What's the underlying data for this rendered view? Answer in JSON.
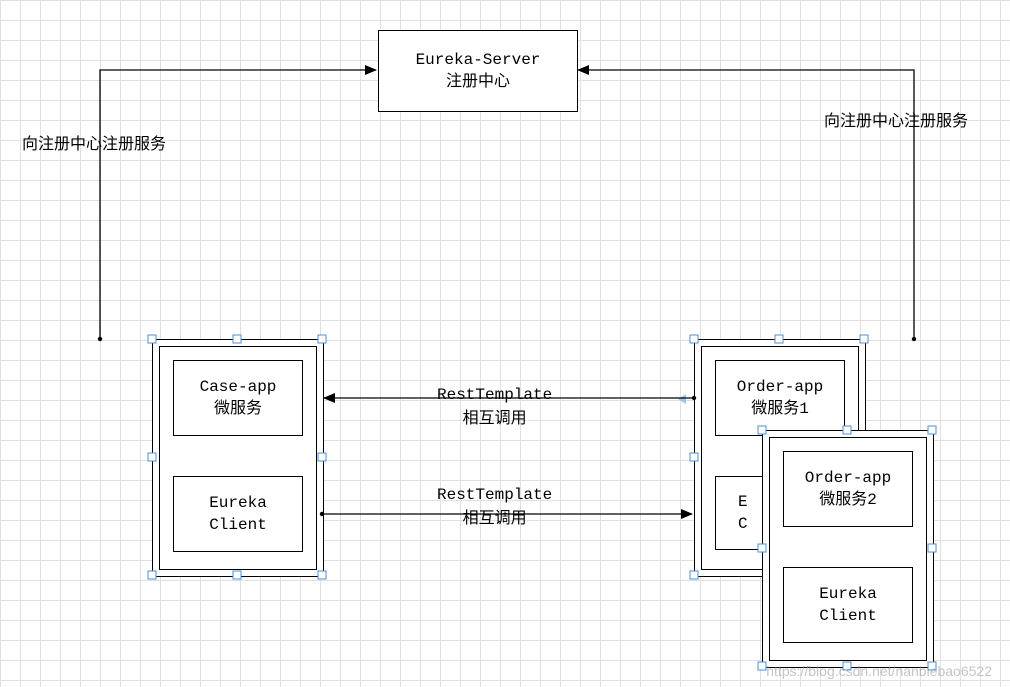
{
  "eureka_server": {
    "line1": "Eureka-Server",
    "line2": "注册中心"
  },
  "case_app": {
    "line1": "Case-app",
    "line2": "微服务"
  },
  "case_client": {
    "line1": "Eureka",
    "line2": "Client"
  },
  "order1": {
    "line1": "Order-app",
    "line2": "微服务1"
  },
  "order1_client_partial": {
    "line1": "E",
    "line2": "C"
  },
  "order2": {
    "line1": "Order-app",
    "line2": "微服务2"
  },
  "order2_client": {
    "line1": "Eureka",
    "line2": "Client"
  },
  "labels": {
    "left_register": "向注册中心注册服务",
    "right_register": "向注册中心注册服务",
    "rest_top": "RestTemplate\n相互调用",
    "rest_bottom": "RestTemplate\n相互调用"
  },
  "watermark": "https://blog.csdn.net/nanbiebao6522"
}
